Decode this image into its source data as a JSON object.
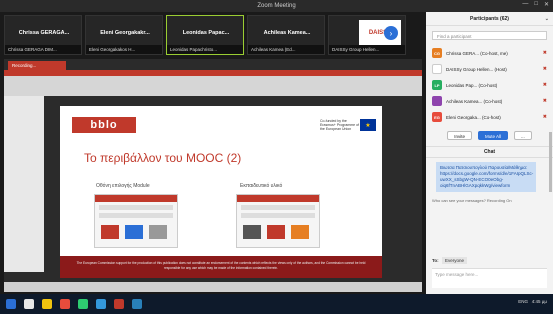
{
  "window": {
    "title": "Zoom Meeting",
    "controls": [
      "—",
      "□",
      "✕"
    ]
  },
  "videoStrip": {
    "tiles": [
      {
        "name": "Chrissa GERAGA...",
        "caption": "Chrissa GERAGA DIM...",
        "active": false
      },
      {
        "name": "Eleni Georgakakr...",
        "caption": "Eleni Georgakakos H...",
        "active": false
      },
      {
        "name": "Leonidas Papac...",
        "caption": "Leonidas Papachristo...",
        "active": true
      },
      {
        "name": "Achileas Kamea...",
        "caption": "Achileas Kamea (Ed...",
        "active": false
      },
      {
        "name": "",
        "caption": "DAISSy Group Hellen...",
        "active": false,
        "logo": "DAISSY"
      }
    ],
    "nextIcon": "chevron-right-icon"
  },
  "share": {
    "badge": "Recording...",
    "slide": {
      "logoText": "bblo",
      "euText": "Co-funded by the Erasmus+ Programme of the European Union",
      "title": "Το περιβάλλον του MOOC (2)",
      "leftLabel": "Οθόνη επιλογής Module",
      "rightLabel": "Εκπαιδευτικό υλικό",
      "footer": "The European Commission support for the production of this publication does not constitute an endorsement of the contents which reflects the views only of the authors, and the Commission cannot be held responsible for any use which may be made of the information contained therein."
    }
  },
  "participants": {
    "title": "Participants (62)",
    "search": "Find a participant",
    "list": [
      {
        "initials": "CG",
        "name": "Chrissa GERA... (Co-host, me)",
        "color": "#e67e22"
      },
      {
        "initials": "",
        "name": "DAISSy Group Hellen... (Host)",
        "color": "#ffffff"
      },
      {
        "initials": "LP",
        "name": "Leonidas Pap... (Co-host)",
        "color": "#27ae60"
      },
      {
        "initials": "",
        "name": "Achileas Kamea... (Co-host)",
        "color": "#8e44ad"
      },
      {
        "initials": "EG",
        "name": "Eleni Georgaka... (Co-host)",
        "color": "#e74c3c"
      }
    ],
    "buttons": {
      "invite": "Invite",
      "muteAll": "Mute All",
      "more": "..."
    }
  },
  "chat": {
    "title": "Chat",
    "message": "Βιωτσα Πατσιουπογλού Παρουσία/Μάθημα: https://docs.google.com/forms/d/e/1FAIpQLSc-uwXX_sSbgW-QN-ECO0eObg-oiq6fTnABHlGAXpqkkWg/viewform",
    "notice": "Who can see your messages? Recording On",
    "toLabel": "To:",
    "toValue": "Everyone",
    "placeholder": "Type message here..."
  },
  "taskbar": {
    "time": "4:45 μμ",
    "lang": "ENG"
  }
}
